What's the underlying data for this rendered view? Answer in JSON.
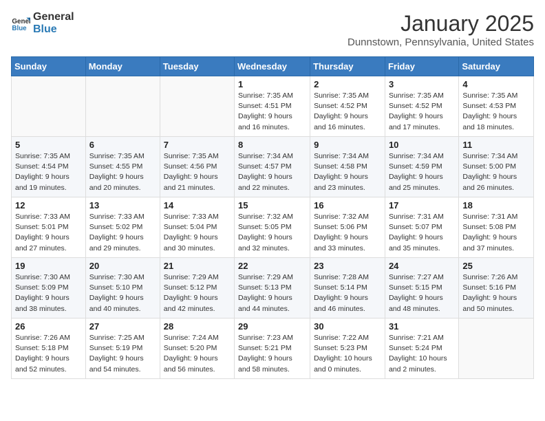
{
  "logo": {
    "line1": "General",
    "line2": "Blue"
  },
  "title": "January 2025",
  "location": "Dunnstown, Pennsylvania, United States",
  "days_of_week": [
    "Sunday",
    "Monday",
    "Tuesday",
    "Wednesday",
    "Thursday",
    "Friday",
    "Saturday"
  ],
  "weeks": [
    [
      {
        "day": "",
        "info": ""
      },
      {
        "day": "",
        "info": ""
      },
      {
        "day": "",
        "info": ""
      },
      {
        "day": "1",
        "info": "Sunrise: 7:35 AM\nSunset: 4:51 PM\nDaylight: 9 hours\nand 16 minutes."
      },
      {
        "day": "2",
        "info": "Sunrise: 7:35 AM\nSunset: 4:52 PM\nDaylight: 9 hours\nand 16 minutes."
      },
      {
        "day": "3",
        "info": "Sunrise: 7:35 AM\nSunset: 4:52 PM\nDaylight: 9 hours\nand 17 minutes."
      },
      {
        "day": "4",
        "info": "Sunrise: 7:35 AM\nSunset: 4:53 PM\nDaylight: 9 hours\nand 18 minutes."
      }
    ],
    [
      {
        "day": "5",
        "info": "Sunrise: 7:35 AM\nSunset: 4:54 PM\nDaylight: 9 hours\nand 19 minutes."
      },
      {
        "day": "6",
        "info": "Sunrise: 7:35 AM\nSunset: 4:55 PM\nDaylight: 9 hours\nand 20 minutes."
      },
      {
        "day": "7",
        "info": "Sunrise: 7:35 AM\nSunset: 4:56 PM\nDaylight: 9 hours\nand 21 minutes."
      },
      {
        "day": "8",
        "info": "Sunrise: 7:34 AM\nSunset: 4:57 PM\nDaylight: 9 hours\nand 22 minutes."
      },
      {
        "day": "9",
        "info": "Sunrise: 7:34 AM\nSunset: 4:58 PM\nDaylight: 9 hours\nand 23 minutes."
      },
      {
        "day": "10",
        "info": "Sunrise: 7:34 AM\nSunset: 4:59 PM\nDaylight: 9 hours\nand 25 minutes."
      },
      {
        "day": "11",
        "info": "Sunrise: 7:34 AM\nSunset: 5:00 PM\nDaylight: 9 hours\nand 26 minutes."
      }
    ],
    [
      {
        "day": "12",
        "info": "Sunrise: 7:33 AM\nSunset: 5:01 PM\nDaylight: 9 hours\nand 27 minutes."
      },
      {
        "day": "13",
        "info": "Sunrise: 7:33 AM\nSunset: 5:02 PM\nDaylight: 9 hours\nand 29 minutes."
      },
      {
        "day": "14",
        "info": "Sunrise: 7:33 AM\nSunset: 5:04 PM\nDaylight: 9 hours\nand 30 minutes."
      },
      {
        "day": "15",
        "info": "Sunrise: 7:32 AM\nSunset: 5:05 PM\nDaylight: 9 hours\nand 32 minutes."
      },
      {
        "day": "16",
        "info": "Sunrise: 7:32 AM\nSunset: 5:06 PM\nDaylight: 9 hours\nand 33 minutes."
      },
      {
        "day": "17",
        "info": "Sunrise: 7:31 AM\nSunset: 5:07 PM\nDaylight: 9 hours\nand 35 minutes."
      },
      {
        "day": "18",
        "info": "Sunrise: 7:31 AM\nSunset: 5:08 PM\nDaylight: 9 hours\nand 37 minutes."
      }
    ],
    [
      {
        "day": "19",
        "info": "Sunrise: 7:30 AM\nSunset: 5:09 PM\nDaylight: 9 hours\nand 38 minutes."
      },
      {
        "day": "20",
        "info": "Sunrise: 7:30 AM\nSunset: 5:10 PM\nDaylight: 9 hours\nand 40 minutes."
      },
      {
        "day": "21",
        "info": "Sunrise: 7:29 AM\nSunset: 5:12 PM\nDaylight: 9 hours\nand 42 minutes."
      },
      {
        "day": "22",
        "info": "Sunrise: 7:29 AM\nSunset: 5:13 PM\nDaylight: 9 hours\nand 44 minutes."
      },
      {
        "day": "23",
        "info": "Sunrise: 7:28 AM\nSunset: 5:14 PM\nDaylight: 9 hours\nand 46 minutes."
      },
      {
        "day": "24",
        "info": "Sunrise: 7:27 AM\nSunset: 5:15 PM\nDaylight: 9 hours\nand 48 minutes."
      },
      {
        "day": "25",
        "info": "Sunrise: 7:26 AM\nSunset: 5:16 PM\nDaylight: 9 hours\nand 50 minutes."
      }
    ],
    [
      {
        "day": "26",
        "info": "Sunrise: 7:26 AM\nSunset: 5:18 PM\nDaylight: 9 hours\nand 52 minutes."
      },
      {
        "day": "27",
        "info": "Sunrise: 7:25 AM\nSunset: 5:19 PM\nDaylight: 9 hours\nand 54 minutes."
      },
      {
        "day": "28",
        "info": "Sunrise: 7:24 AM\nSunset: 5:20 PM\nDaylight: 9 hours\nand 56 minutes."
      },
      {
        "day": "29",
        "info": "Sunrise: 7:23 AM\nSunset: 5:21 PM\nDaylight: 9 hours\nand 58 minutes."
      },
      {
        "day": "30",
        "info": "Sunrise: 7:22 AM\nSunset: 5:23 PM\nDaylight: 10 hours\nand 0 minutes."
      },
      {
        "day": "31",
        "info": "Sunrise: 7:21 AM\nSunset: 5:24 PM\nDaylight: 10 hours\nand 2 minutes."
      },
      {
        "day": "",
        "info": ""
      }
    ]
  ]
}
